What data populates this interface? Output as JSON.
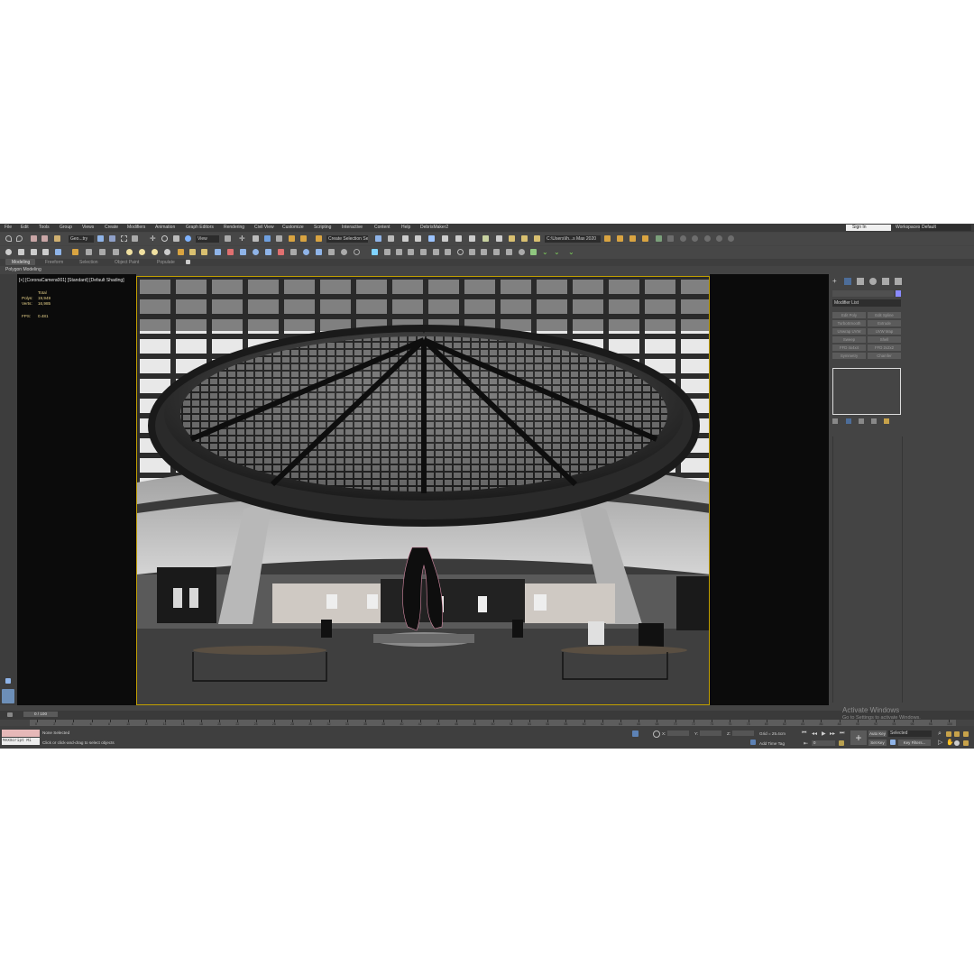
{
  "menu": [
    "File",
    "Edit",
    "Tools",
    "Group",
    "Views",
    "Create",
    "Modifiers",
    "Animation",
    "Graph Editors",
    "Rendering",
    "Civil View",
    "Customize",
    "Scripting",
    "Interactive",
    "Content",
    "Help",
    "DebrisMaker2"
  ],
  "account": {
    "sign_in": "Sign In",
    "workspaces_label": "Workspaces:",
    "workspace": "Default"
  },
  "toolbar": {
    "selection_filter": "Geo...try",
    "reference_coord": "View",
    "selection_set": "Create Selection Se",
    "project_path": "C:\\Users\\Ih...s Max 2020"
  },
  "ribbon": {
    "tabs": [
      "Modeling",
      "Freeform",
      "Selection",
      "Object Paint",
      "Populate"
    ],
    "active_tab": "Modeling",
    "panel": "Polygon Modeling"
  },
  "viewport": {
    "label": "[+] [CoronaCamera001] [Standard] [Default Shading]",
    "stats": {
      "total_label": "Total",
      "polys_label": "Polys:",
      "polys": "19,949",
      "verts_label": "Verts:",
      "verts": "16,985",
      "fps_label": "FPS:",
      "fps": "0.481"
    }
  },
  "command_panel": {
    "modifier_list": "Modifier List",
    "buttons": [
      "Edit Poly",
      "Edit Spline",
      "TurboSmooth",
      "Extrude",
      "Unwrap UVW",
      "UVW Map",
      "Sweep",
      "Shell",
      "FFD 4x4x4",
      "FFD 2x2x2",
      "Symmetry",
      "Chamfer"
    ]
  },
  "timeline": {
    "slider": "0 / 100",
    "ticks": [
      "0",
      "2",
      "4",
      "6",
      "8",
      "10",
      "12",
      "14",
      "16",
      "18",
      "20",
      "22",
      "24",
      "26",
      "28",
      "30",
      "32",
      "34",
      "36",
      "38",
      "40",
      "42",
      "44",
      "46",
      "48",
      "50",
      "52",
      "54",
      "56",
      "58",
      "60",
      "62",
      "64",
      "66",
      "68",
      "70",
      "72",
      "74",
      "76",
      "78",
      "80",
      "82",
      "84",
      "86",
      "88",
      "90",
      "92",
      "94",
      "96",
      "98",
      "100"
    ]
  },
  "status": {
    "maxscript": "MAXScript Mi",
    "selected": "None Selected",
    "prompt": "Click or click-and-drag to select objects",
    "x_label": "X:",
    "y_label": "Y:",
    "z_label": "Z:",
    "grid": "Grid = 25.4cm",
    "add_time_tag": "Add Time Tag",
    "auto_key": "Auto Key",
    "set_key": "Set Key",
    "key_mode": "Selected",
    "key_filters": "Key Filters...",
    "frame": "0"
  },
  "watermark": {
    "title": "Activate Windows",
    "subtitle": "Go to Settings to activate Windows."
  }
}
